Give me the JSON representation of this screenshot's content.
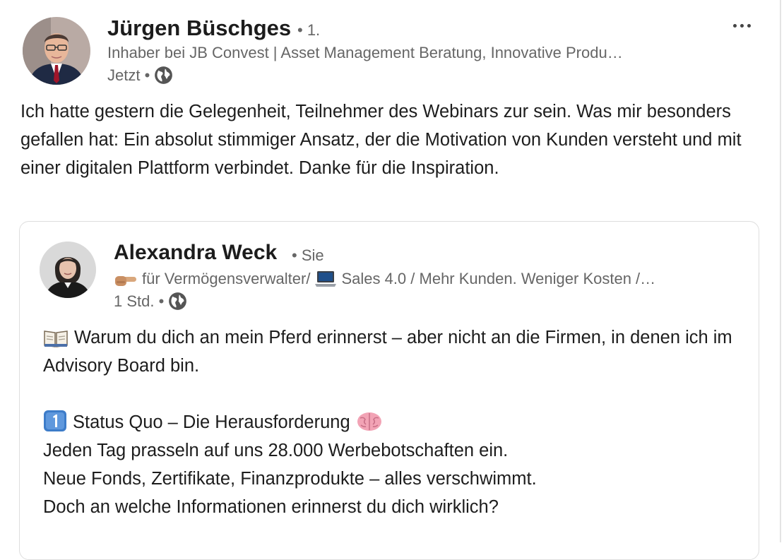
{
  "post": {
    "author": {
      "name": "Jürgen Büschges",
      "degree": "• 1.",
      "headline": "Inhaber bei JB Convest | Asset Management Beratung, Innovative Produ…",
      "time": "Jetzt •",
      "visibility_icon": "globe-icon"
    },
    "text": "Ich hatte gestern die Gelegenheit, Teilnehmer des Webinars zur sein. Was mir besonders gefallen hat: Ein absolut stimmiger Ansatz, der die Motivation von Kunden versteht und mit einer digitalen Plattform verbindet. Danke für die Inspiration.",
    "more_icon": "more-horizontal-icon"
  },
  "shared_post": {
    "author": {
      "name": "Alexandra Weck",
      "relation": "• Sie",
      "headline_part1": "für Vermögensverwalter/",
      "headline_part2": "Sales 4.0 / Mehr Kunden. Weniger Kosten /…",
      "time": "1 Std. •",
      "visibility_icon": "globe-icon"
    },
    "lines": {
      "line1": "Warum du dich an mein Pferd erinnerst – aber nicht an die Firmen, in denen ich im Advisory Board bin.",
      "line2": "Status Quo – Die Herausforderung",
      "line3": "Jeden Tag prasseln auf uns 28.000 Werbebotschaften ein.",
      "line4": "Neue Fonds, Zertifikate, Finanzprodukte – alles verschwimmt.",
      "line5": "Doch an welche Informationen erinnerst du dich wirklich?"
    },
    "icons": {
      "pointing": "pointing-hand-icon",
      "laptop": "laptop-icon",
      "book": "open-book-icon",
      "keycap": "keycap-one-icon",
      "brain": "brain-icon"
    }
  }
}
